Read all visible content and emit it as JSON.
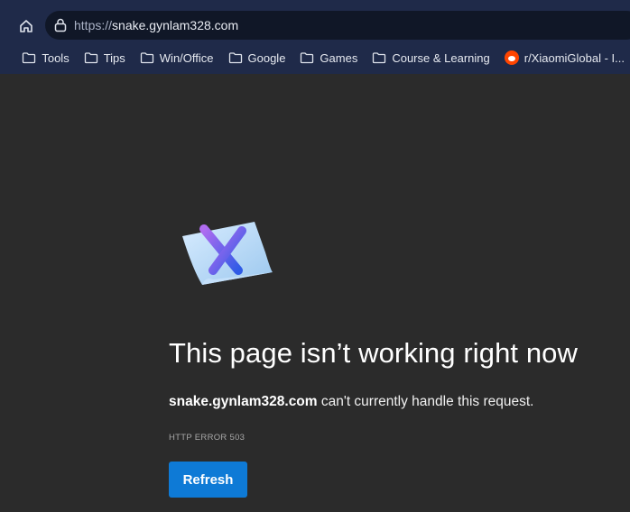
{
  "browser": {
    "url_scheme": "https://",
    "url_host": "snake.gynlam328.com",
    "bookmarks": [
      {
        "label": "Tools",
        "icon": "folder-icon"
      },
      {
        "label": "Tips",
        "icon": "folder-icon"
      },
      {
        "label": "Win/Office",
        "icon": "folder-icon"
      },
      {
        "label": "Google",
        "icon": "folder-icon"
      },
      {
        "label": "Games",
        "icon": "folder-icon"
      },
      {
        "label": "Course & Learning",
        "icon": "folder-icon"
      },
      {
        "label": "r/XiaomiGlobal - I...",
        "icon": "reddit-icon"
      }
    ]
  },
  "error_page": {
    "title": "This page isn’t working right now",
    "host": "snake.gynlam328.com",
    "message": " can't currently handle this request.",
    "code": "HTTP ERROR 503",
    "refresh_label": "Refresh"
  },
  "colors": {
    "background": "#2b2b2b",
    "toolbar": "#1f2a49",
    "accent": "#0e7ad6"
  }
}
